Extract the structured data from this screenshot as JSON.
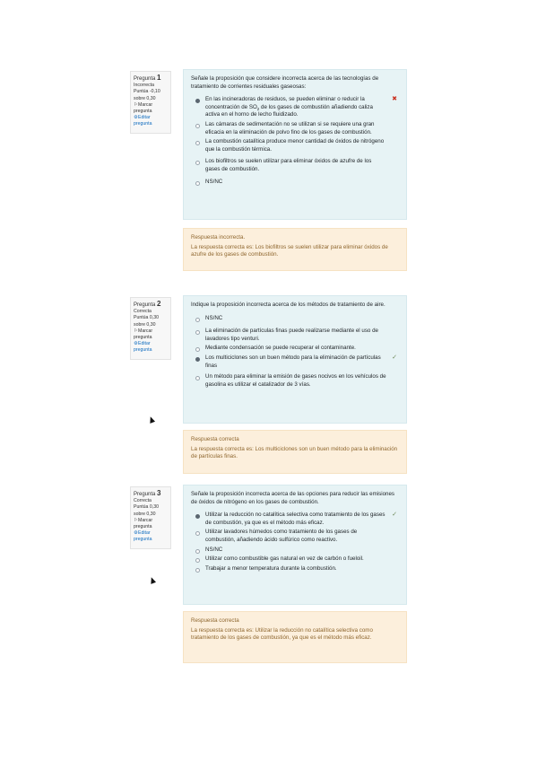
{
  "questions": [
    {
      "label": "Pregunta",
      "number": "1",
      "state": "Incorrecta",
      "score": "Puntúa -0,10 sobre 0,30",
      "flag": "Marcar pregunta",
      "edit": "Editar pregunta",
      "text": "Señale la proposición que considere incorrecta acerca de las tecnologías de tratamiento de corrientes residuales gaseosas:",
      "options": [
        {
          "pre": "En las incineradoras de residuos, se pueden eliminar o reducir la concentración de SO",
          "sub": "2",
          "post": " de los gases de combustión añadiendo caliza activa en el horno de lecho fluidizado.",
          "selected": true,
          "mark": "✖"
        },
        {
          "text": "Las cámaras de sedimentación no se utilizan si se requiere una gran eficacia en la eliminación de polvo fino de los gases de combustión."
        },
        {
          "text": "La combustión catalítica produce menor cantidad de óxidos de nitrógeno que la combustión térmica."
        },
        {
          "text": "Los biofiltros se suelen utilizar para eliminar óxidos de azufre de los gases de combustión."
        },
        {
          "text": "NS/NC"
        }
      ],
      "feedback_state": "Respuesta incorrecta.",
      "feedback": "La respuesta correcta es: Los biofiltros se suelen utilizar para eliminar óxidos de azufre de los gases de combustión."
    },
    {
      "label": "Pregunta",
      "number": "2",
      "state": "Correcta",
      "score": "Puntúa 0,30 sobre 0,30",
      "flag": "Marcar pregunta",
      "edit": "Editar pregunta",
      "text": "Indique la proposición incorrecta acerca de los métodos de tratamiento de aire.",
      "options": [
        {
          "text": "NS/NC"
        },
        {
          "text": "La eliminación de partículas finas puede realizarse mediante el uso de lavadores tipo venturi."
        },
        {
          "text": "Mediante condensación se puede recuperar el contaminante."
        },
        {
          "text": "Los multiciclones son un buen método para la eliminación de partículas finas",
          "selected": true,
          "mark": "✓"
        },
        {
          "text": "Un método para eliminar la emisión de gases nocivos en los vehículos de gasolina es utilizar el catalizador de 3 vías."
        }
      ],
      "feedback_state": "Respuesta correcta",
      "feedback": "La respuesta correcta es: Los multiciclones son un buen método para la eliminación de partículas finas."
    },
    {
      "label": "Pregunta",
      "number": "3",
      "state": "Correcta",
      "score": "Puntúa 0,30 sobre 0,30",
      "flag": "Marcar pregunta",
      "edit": "Editar pregunta",
      "text": "Señale la proposición incorrecta acerca de las opciones para reducir las emisiones de óxidos de nitrógeno en los gases de combustión.",
      "options": [
        {
          "text": "Utilizar la reducción no catalítica selectiva como tratamiento de los gases de combustión, ya que es el método más eficaz.",
          "selected": true,
          "mark": "✓"
        },
        {
          "text": "Utilizar lavadores húmedos como tratamiento de los gases de combustión, añadiendo ácido sulfúrico como reactivo."
        },
        {
          "text": "NS/NC"
        },
        {
          "text": "Utilizar como combustible gas natural en vez de carbón o fueloil."
        },
        {
          "text": "Trabajar a menor temperatura durante la combustión."
        }
      ],
      "feedback_state": "Respuesta correcta",
      "feedback": "La respuesta correcta es: Utilizar la reducción no catalítica selectiva como tratamiento de los gases de combustión, ya que es el método más eficaz."
    }
  ]
}
